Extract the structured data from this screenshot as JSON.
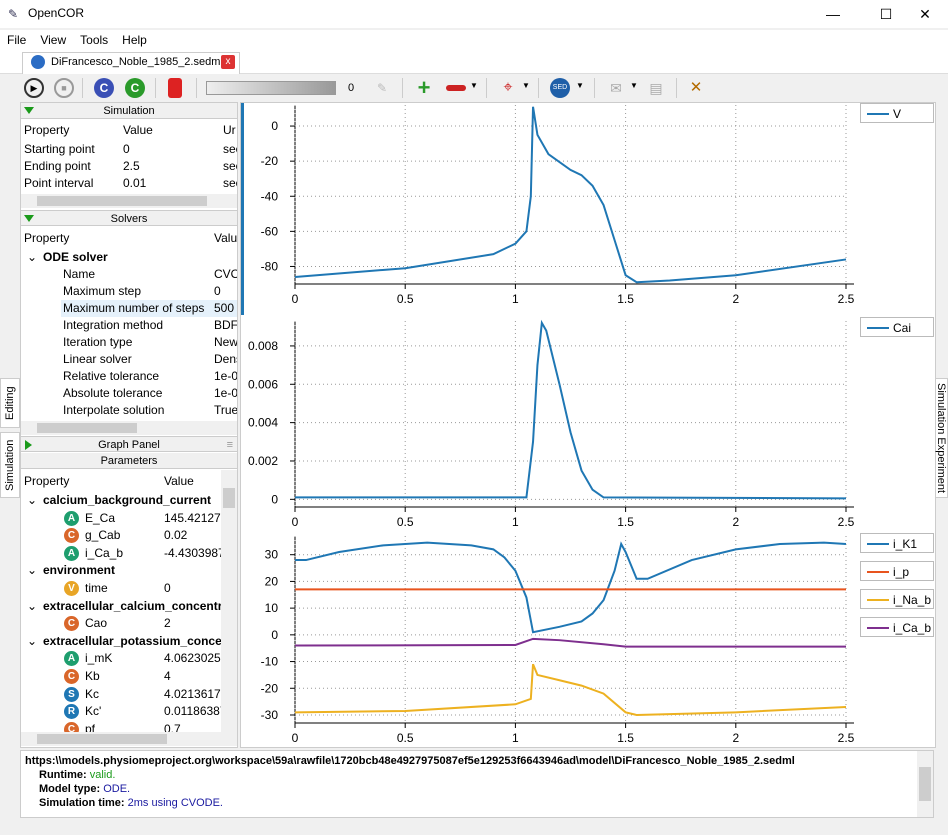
{
  "app": {
    "title": "OpenCOR",
    "minimize": "—",
    "maximize": "☐",
    "close": "✕"
  },
  "menu": [
    "File",
    "View",
    "Tools",
    "Help"
  ],
  "tab": {
    "label": "DiFrancesco_Noble_1985_2.sedml",
    "close": "x"
  },
  "toolbar": {
    "progress_value": "0",
    "icons": [
      "run-icon",
      "stop-icon",
      "reset-icon",
      "clear-icon",
      "delete-data-icon",
      "settings-icon",
      "add-graph-panel-icon",
      "remove-graph-panel-icon",
      "zoom-icon",
      "sedml-export-icon",
      "cellml-export-icon",
      "file-export-icon",
      "tools-icon"
    ],
    "progress_fraction": 0.0
  },
  "sidetabs": {
    "editing": "Editing",
    "simulation": "Simulation",
    "right": "Simulation Experiment"
  },
  "simulation": {
    "header": "Simulation",
    "col_property": "Property",
    "col_value": "Value",
    "col_unit": "Ur",
    "rows": [
      {
        "p": "Starting point",
        "v": "0",
        "u": "sec"
      },
      {
        "p": "Ending point",
        "v": "2.5",
        "u": "sec"
      },
      {
        "p": "Point interval",
        "v": "0.01",
        "u": "sec"
      }
    ]
  },
  "solvers": {
    "header": "Solvers",
    "col_property": "Property",
    "col_value": "Valu",
    "group": "ODE solver",
    "rows": [
      {
        "p": "Name",
        "v": "CVO"
      },
      {
        "p": "Maximum step",
        "v": "0"
      },
      {
        "p": "Maximum number of steps",
        "v": "500"
      },
      {
        "p": "Integration method",
        "v": "BDF"
      },
      {
        "p": "Iteration type",
        "v": "New"
      },
      {
        "p": "Linear solver",
        "v": "Dens"
      },
      {
        "p": "Relative tolerance",
        "v": "1e-0"
      },
      {
        "p": "Absolute tolerance",
        "v": "1e-0"
      },
      {
        "p": "Interpolate solution",
        "v": "True"
      }
    ]
  },
  "graph_panel": {
    "header": "Graph Panel"
  },
  "parameters": {
    "header": "Parameters",
    "col_property": "Property",
    "col_value": "Value",
    "rows": [
      {
        "g": "calcium_background_current"
      },
      {
        "b": "A",
        "p": "E_Ca",
        "v": "145.421279"
      },
      {
        "b": "C",
        "p": "g_Cab",
        "v": "0.02"
      },
      {
        "b": "A",
        "p": "i_Ca_b",
        "v": "-4.4303987"
      },
      {
        "g": "environment"
      },
      {
        "b": "V",
        "p": "time",
        "v": "0"
      },
      {
        "g": "extracellular_calcium_concentra"
      },
      {
        "b": "C",
        "p": "Cao",
        "v": "2"
      },
      {
        "g": "extracellular_potassium_concen"
      },
      {
        "b": "A",
        "p": "i_mK",
        "v": "4.06230252"
      },
      {
        "b": "C",
        "p": "Kb",
        "v": "4"
      },
      {
        "b": "S",
        "p": "Kc",
        "v": "4.02136170"
      },
      {
        "b": "R",
        "p": "Kc'",
        "v": "0.01186387"
      },
      {
        "b": "C",
        "p": "pf",
        "v": "0.7"
      }
    ],
    "badge_colors": {
      "A": "#1e9e6e",
      "C": "#d9662a",
      "V": "#e8a526",
      "S": "#1f77b4",
      "R": "#1f77b4"
    }
  },
  "output": {
    "url": "https:\\\\models.physiomeproject.org\\workspace\\59a\\rawfile\\1720bcb48e4927975087ef5e129253f6643946ad\\model\\DiFrancesco_Noble_1985_2.sedml",
    "runtime_label": "Runtime:",
    "runtime_value": "valid.",
    "model_type_label": "Model type:",
    "model_type_value": "ODE.",
    "sim_time_label": "Simulation time:",
    "sim_time_value": "2ms using CVODE."
  },
  "chart_data": [
    {
      "type": "line",
      "xlim": [
        0,
        2.5
      ],
      "ylim": [
        -90,
        12
      ],
      "xticks": [
        "0",
        "0.5",
        "1",
        "1.5",
        "2",
        "2.5"
      ],
      "yticks": [
        "0",
        "-20",
        "-40",
        "-60",
        "-80"
      ],
      "grid": true,
      "legend": "right",
      "series": [
        {
          "name": "V",
          "color": "#1f77b4",
          "x": [
            0,
            0.5,
            0.9,
            1.0,
            1.05,
            1.07,
            1.08,
            1.1,
            1.15,
            1.25,
            1.3,
            1.35,
            1.4,
            1.45,
            1.5,
            1.55,
            1.7,
            2.0,
            2.5
          ],
          "y": [
            -86,
            -81,
            -73,
            -67,
            -60,
            -40,
            11,
            -5,
            -16,
            -25,
            -28,
            -34,
            -45,
            -65,
            -85,
            -89,
            -88,
            -85,
            -76
          ]
        }
      ]
    },
    {
      "type": "line",
      "xlim": [
        0,
        2.5
      ],
      "ylim": [
        -0.0004,
        0.0093
      ],
      "xticks": [
        "0",
        "0.5",
        "1",
        "1.5",
        "2",
        "2.5"
      ],
      "yticks": [
        "0",
        "0.002",
        "0.004",
        "0.006",
        "0.008"
      ],
      "grid": true,
      "legend": "right",
      "series": [
        {
          "name": "Cai",
          "color": "#1f77b4",
          "x": [
            0,
            1.05,
            1.08,
            1.1,
            1.12,
            1.14,
            1.2,
            1.25,
            1.3,
            1.35,
            1.4,
            2.5
          ],
          "y": [
            0.0001,
            0.0001,
            0.003,
            0.007,
            0.0092,
            0.0088,
            0.006,
            0.0035,
            0.0015,
            0.0005,
            0.0001,
            5e-05
          ]
        }
      ]
    },
    {
      "type": "line",
      "xlim": [
        0,
        2.5
      ],
      "ylim": [
        -33,
        37
      ],
      "xticks": [
        "0",
        "0.5",
        "1",
        "1.5",
        "2",
        "2.5"
      ],
      "yticks": [
        "30",
        "20",
        "10",
        "0",
        "-10",
        "-20",
        "-30"
      ],
      "grid": true,
      "legend": "right",
      "series": [
        {
          "name": "i_K1",
          "color": "#1f77b4",
          "x": [
            0,
            0.05,
            0.2,
            0.4,
            0.6,
            0.8,
            0.9,
            0.95,
            1.0,
            1.05,
            1.08,
            1.2,
            1.3,
            1.35,
            1.4,
            1.45,
            1.48,
            1.5,
            1.55,
            1.6,
            1.8,
            2.0,
            2.2,
            2.4,
            2.5
          ],
          "y": [
            28,
            28,
            31,
            33.5,
            34.5,
            33.5,
            32,
            29,
            24,
            14,
            1,
            3,
            5,
            8,
            13,
            24,
            34,
            31,
            21,
            21,
            28,
            32,
            34,
            34.5,
            34
          ]
        },
        {
          "name": "i_p",
          "color": "#e8541e",
          "x": [
            0,
            2.5
          ],
          "y": [
            17,
            17
          ]
        },
        {
          "name": "i_Na_b",
          "color": "#edb120",
          "x": [
            0,
            0.5,
            1.0,
            1.07,
            1.08,
            1.1,
            1.2,
            1.3,
            1.4,
            1.5,
            1.55,
            2.0,
            2.5
          ],
          "y": [
            -29,
            -28.5,
            -26,
            -24,
            -11,
            -15,
            -17,
            -19,
            -22,
            -29,
            -30,
            -29,
            -27
          ]
        },
        {
          "name": "i_Ca_b",
          "color": "#7e2f8e",
          "x": [
            0,
            1.0,
            1.08,
            1.2,
            1.4,
            1.5,
            2.5
          ],
          "y": [
            -4,
            -3.8,
            -1.5,
            -2,
            -3.5,
            -4.4,
            -4.4
          ]
        }
      ]
    }
  ]
}
